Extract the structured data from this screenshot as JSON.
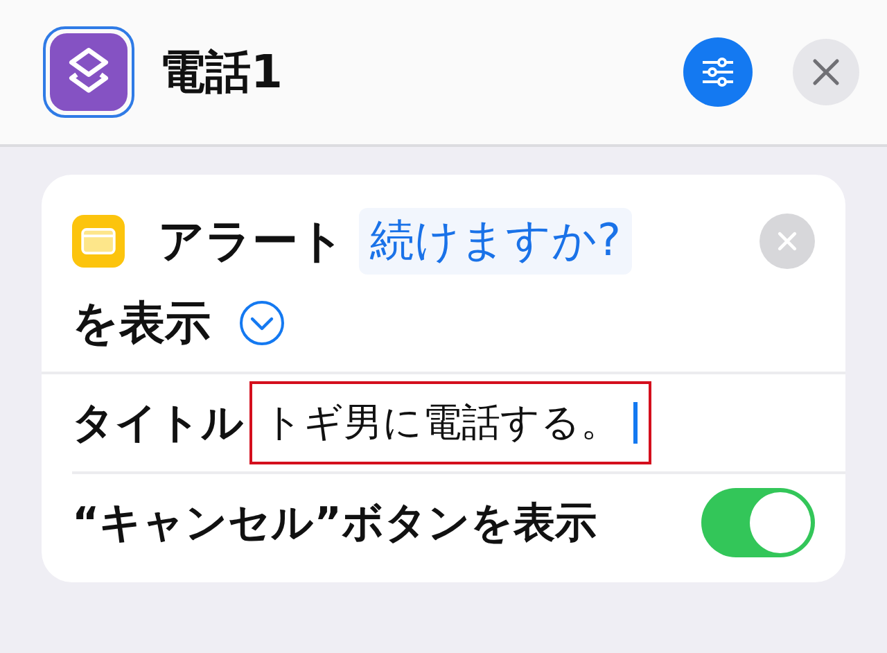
{
  "header": {
    "title": "電話1"
  },
  "action": {
    "name": "アラート",
    "token": "続けますか?",
    "suffix": "を表示",
    "expanded": false,
    "fields": [
      {
        "kind": "text",
        "label": "タイトル",
        "value": "トギ男に電話する。",
        "focused": true,
        "highlighted": true
      },
      {
        "kind": "toggle",
        "label": "“キャンセル”ボタンを表示",
        "on": true
      }
    ]
  }
}
